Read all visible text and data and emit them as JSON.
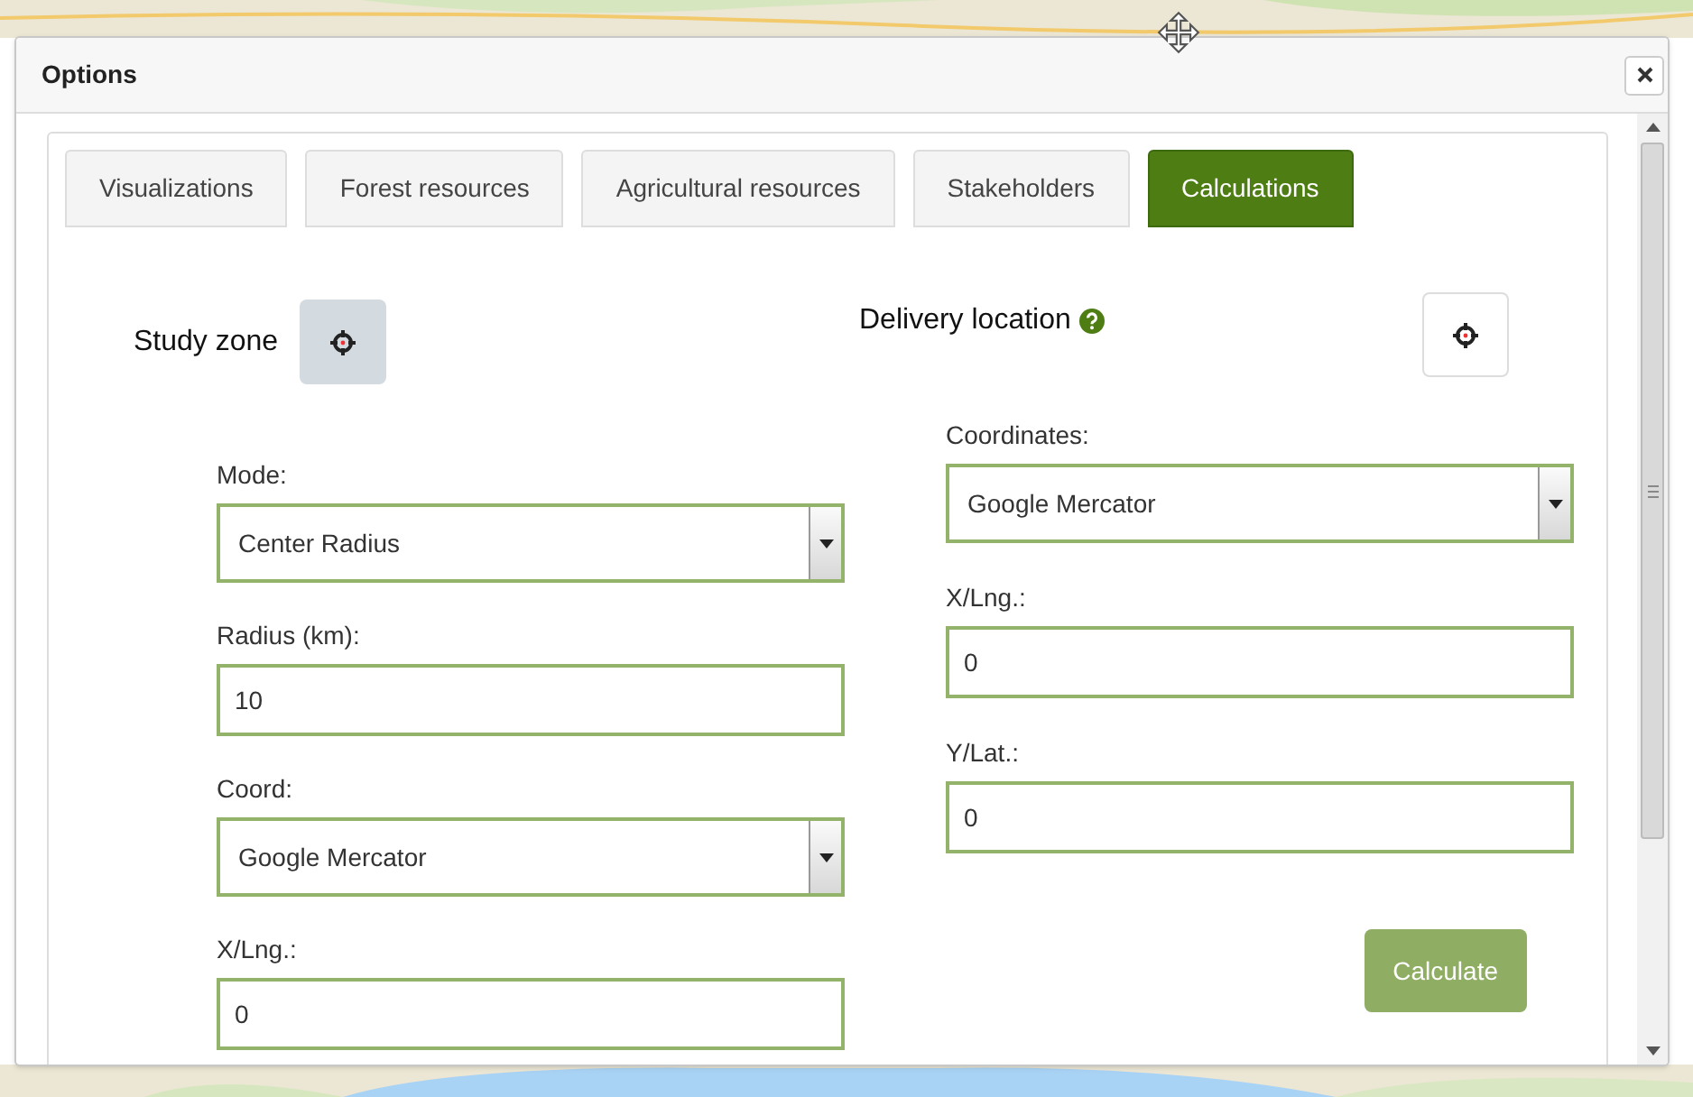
{
  "dialog": {
    "title": "Options"
  },
  "tabs": [
    {
      "label": "Visualizations",
      "selected": false
    },
    {
      "label": "Forest resources",
      "selected": false
    },
    {
      "label": "Agricultural resources",
      "selected": false
    },
    {
      "label": "Stakeholders",
      "selected": false
    },
    {
      "label": "Calculations",
      "selected": true
    }
  ],
  "study_zone": {
    "title": "Study zone",
    "fields": [
      {
        "kind": "select",
        "label": "Mode:",
        "value": "Center Radius"
      },
      {
        "kind": "input",
        "label": "Radius (km):",
        "value": "10"
      },
      {
        "kind": "select",
        "label": "Coord:",
        "value": "Google Mercator"
      },
      {
        "kind": "input",
        "label": "X/Lng.:",
        "value": "0"
      }
    ]
  },
  "delivery_location": {
    "title": "Delivery location",
    "fields": [
      {
        "kind": "select",
        "label": "Coordinates:",
        "value": "Google Mercator"
      },
      {
        "kind": "input",
        "label": "X/Lng.:",
        "value": "0"
      },
      {
        "kind": "input",
        "label": "Y/Lat.:",
        "value": "0"
      }
    ]
  },
  "calculate_button": {
    "label": "Calculate",
    "disabled": true
  }
}
